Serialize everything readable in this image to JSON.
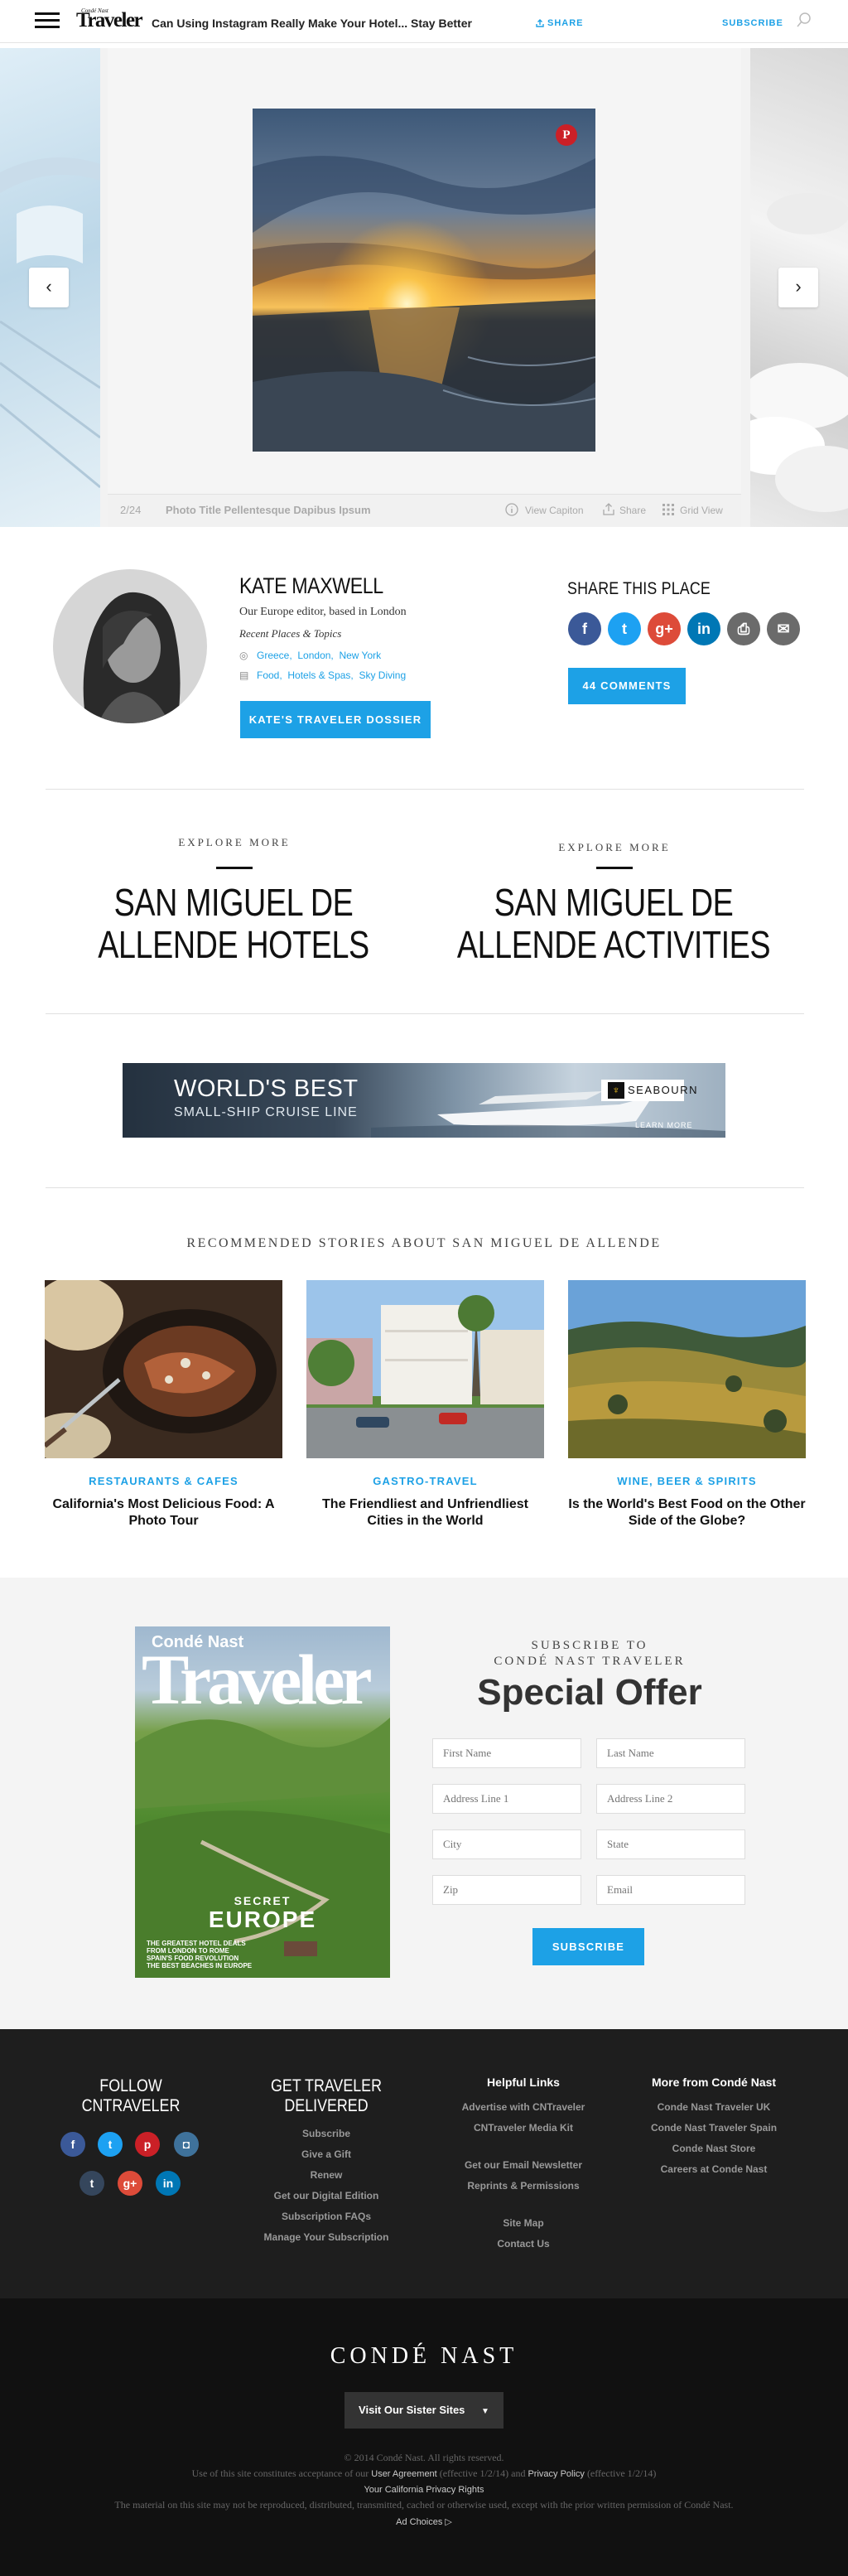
{
  "header": {
    "brand_small": "Condé Nast",
    "brand": "Traveler",
    "article_title": "Can Using Instagram Really Make Your Hotel... Stay Better",
    "share_label": "SHARE",
    "subscribe_label": "SUBSCRIBE",
    "icons": [
      "menu-icon",
      "share-icon",
      "search-icon"
    ]
  },
  "gallery": {
    "counter": "2/24",
    "photo_title": "Photo Title Pellentesque Dapibus Ipsum",
    "view_caption": "View Capiton",
    "share": "Share",
    "grid_view": "Grid View",
    "pin_label": "P",
    "prev_label": "‹",
    "next_label": "›"
  },
  "author": {
    "name": "KATE MAXWELL",
    "bio": "Our Europe editor, based in London",
    "recent_label": "Recent Places & Topics",
    "places": [
      "Greece",
      "London",
      "New York"
    ],
    "topics": [
      "Food",
      "Hotels & Spas",
      "Sky Diving"
    ],
    "dossier_button": "KATE'S TRAVELER DOSSIER"
  },
  "share_place": {
    "title": "SHARE THIS PLACE",
    "networks": [
      {
        "name": "facebook",
        "glyph": "f",
        "color": "#3b5998"
      },
      {
        "name": "twitter",
        "glyph": "t",
        "color": "#1da1f2"
      },
      {
        "name": "google-plus",
        "glyph": "g+",
        "color": "#dd4b39"
      },
      {
        "name": "linkedin",
        "glyph": "in",
        "color": "#0077b5"
      },
      {
        "name": "print",
        "glyph": "⎙",
        "color": "#6b6b6b"
      },
      {
        "name": "email",
        "glyph": "✉",
        "color": "#6b6b6b"
      }
    ],
    "comments_button": "44 COMMENTS"
  },
  "explore": [
    {
      "kicker": "EXPLORE MORE",
      "title_line1": "SAN MIGUEL DE",
      "title_line2": "ALLENDE HOTELS"
    },
    {
      "kicker": "EXPLORE MORE",
      "title_line1": "SAN MIGUEL DE",
      "title_line2": "ALLENDE ACTIVITIES"
    }
  ],
  "ad": {
    "line1": "WORLD'S BEST",
    "line2": "SMALL-SHIP CRUISE LINE",
    "brand": "SEABOURN",
    "cta": "LEARN MORE"
  },
  "recommended": {
    "title": "RECOMMENDED STORIES ABOUT SAN MIGUEL DE ALLENDE",
    "items": [
      {
        "category": "RESTAURANTS & CAFES",
        "title": "California's Most Delicious Food: A Photo Tour"
      },
      {
        "category": "GASTRO-TRAVEL",
        "title": "The Friendliest and Unfriendliest Cities in the World"
      },
      {
        "category": "WINE, BEER & SPIRITS",
        "title": "Is the World's Best Food on the Other Side of the Globe?"
      }
    ]
  },
  "subscribe": {
    "kicker_line1": "SUBSCRIBE TO",
    "kicker_line2": "CONDÉ NAST TRAVELER",
    "headline": "Special Offer",
    "fields": {
      "first_name": "First Name",
      "last_name": "Last Name",
      "address1": "Address Line 1",
      "address2": "Address Line 2",
      "city": "City",
      "state": "State",
      "zip": "Zip",
      "email": "Email"
    },
    "button": "SUBSCRIBE",
    "cover": {
      "brand_small": "Condé Nast",
      "brand": "Traveler",
      "feature_small": "SECRET",
      "feature": "EUROPE",
      "blurb1": "THE GREATEST HOTEL DEALS",
      "blurb2": "FROM LONDON TO ROME",
      "blurb3": "SPAIN'S FOOD REVOLUTION",
      "blurb4": "THE BEST BEACHES IN EUROPE"
    }
  },
  "footer": {
    "follow_title_1": "FOLLOW",
    "follow_title_2": "CNTRAVELER",
    "follow_networks": [
      {
        "name": "facebook",
        "glyph": "f",
        "color": "#3b5998"
      },
      {
        "name": "twitter",
        "glyph": "t",
        "color": "#1da1f2"
      },
      {
        "name": "pinterest",
        "glyph": "p",
        "color": "#cb2027"
      },
      {
        "name": "instagram",
        "glyph": "◘",
        "color": "#3f729b"
      },
      {
        "name": "tumblr",
        "glyph": "t",
        "color": "#35465c"
      },
      {
        "name": "google-plus",
        "glyph": "g+",
        "color": "#dd4b39"
      },
      {
        "name": "linkedin",
        "glyph": "in",
        "color": "#0077b5"
      }
    ],
    "get_title_1": "GET TRAVELER",
    "get_title_2": "DELIVERED",
    "get_links": [
      "Subscribe",
      "Give a Gift",
      "Renew",
      "Get our Digital Edition",
      "Subscription FAQs",
      "Manage Your Subscription"
    ],
    "helpful_title": "Helpful Links",
    "helpful_links_a": [
      "Advertise with CNTraveler",
      "CNTraveler Media Kit"
    ],
    "helpful_links_b": [
      "Get our Email Newsletter",
      "Reprints & Permissions"
    ],
    "helpful_links_c": [
      "Site Map",
      "Contact Us"
    ],
    "more_title": "More from Condé Nast",
    "more_links": [
      "Conde Nast Traveler UK",
      "Conde Nast Traveler Spain",
      "Conde Nast Store",
      "Careers at Conde Nast"
    ]
  },
  "legal": {
    "logo": "CONDÉ NAST",
    "sister_sites": "Visit Our Sister Sites",
    "copyright": "© 2014 Condé Nast. All rights reserved.",
    "line2_a": "Use of this site constitutes acceptance of our",
    "user_agreement": "User Agreement",
    "line2_b": "(effective 1/2/14) and",
    "privacy_policy": "Privacy Policy",
    "line2_c": "(effective 1/2/14)",
    "ca_privacy": "Your California Privacy Rights",
    "line4": "The material on this site may not be reproduced, distributed, transmitted, cached or otherwise used, except with the prior written permission of Condé Nast.",
    "ad_choices": "Ad Choices ▷"
  }
}
